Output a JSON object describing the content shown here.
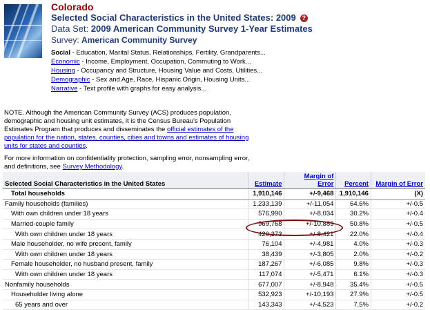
{
  "header": {
    "state": "Colorado",
    "title": "Selected Social Characteristics in the United States: 2009",
    "help_icon": "question-mark-icon",
    "dataset_label": "Data Set:",
    "dataset_value": "2009 American Community Survey 1-Year Estimates",
    "survey_label": "Survey:",
    "survey_value": "American Community Survey"
  },
  "themes": [
    {
      "name": "Social",
      "desc": " - Education, Marital Status, Relationships, Fertility, Grandparents..."
    },
    {
      "name": "Economic",
      "desc": " - Income, Employment, Occupation, Commuting to Work..."
    },
    {
      "name": "Housing",
      "desc": " - Occupancy and Structure, Housing Value and Costs, Utilities..."
    },
    {
      "name": "Demographic",
      "desc": " - Sex and Age, Race, Hispanic Origin, Housing Units..."
    },
    {
      "name": "Narrative",
      "desc": " - Text profile with graphs for easy analysis..."
    }
  ],
  "note": {
    "text": "NOTE. Although the American Community Survey (ACS) produces population, demographic and housing unit estimates, it is the Census Bureau's Population Estimates Program that produces and disseminates the ",
    "link": "official estimates of the population for the nation, states, counties, cities and towns and estimates of housing units for states and counties",
    "end": "."
  },
  "info": {
    "text": "For more information on confidentiality protection, sampling error, nonsampling error, and definitions, see ",
    "link": "Survey Methodology",
    "end": "."
  },
  "table": {
    "headers": {
      "characteristic": "Selected Social Characteristics in the United States",
      "estimate": "Estimate",
      "moe": "Margin of Error",
      "percent": "Percent",
      "moe2": "Margin of Error"
    },
    "rows": [
      {
        "label": "Total households",
        "estimate": "1,910,146",
        "moe": "+/-9,468",
        "percent": "1,910,146",
        "moe2": "(X)"
      },
      {
        "label": "Family households (families)",
        "estimate": "1,233,139",
        "moe": "+/-11,054",
        "percent": "64.6%",
        "moe2": "+/-0.5"
      },
      {
        "label": "With own children under 18 years",
        "estimate": "576,990",
        "moe": "+/-8,034",
        "percent": "30.2%",
        "moe2": "+/-0.4"
      },
      {
        "label": "Married-couple family",
        "estimate": "969,768",
        "moe": "+/-10,889",
        "percent": "50.8%",
        "moe2": "+/-0.5"
      },
      {
        "label": "With own children under 18 years",
        "estimate": "420,373",
        "moe": "+/-8,421",
        "percent": "22.0%",
        "moe2": "+/-0.4"
      },
      {
        "label": "Male householder, no wife present, family",
        "estimate": "76,104",
        "moe": "+/-4,981",
        "percent": "4.0%",
        "moe2": "+/-0.3"
      },
      {
        "label": "With own children under 18 years",
        "estimate": "38,439",
        "moe": "+/-3,805",
        "percent": "2.0%",
        "moe2": "+/-0.2"
      },
      {
        "label": "Female householder, no husband present, family",
        "estimate": "187,267",
        "moe": "+/-6,085",
        "percent": "9.8%",
        "moe2": "+/-0.3"
      },
      {
        "label": "With own children under 18 years",
        "estimate": "117,074",
        "moe": "+/-5,471",
        "percent": "6.1%",
        "moe2": "+/-0.3"
      },
      {
        "label": "Nonfamily households",
        "estimate": "677,007",
        "moe": "+/-8,948",
        "percent": "35.4%",
        "moe2": "+/-0.5"
      },
      {
        "label": "Householder living alone",
        "estimate": "532,923",
        "moe": "+/-10,193",
        "percent": "27.9%",
        "moe2": "+/-0.5"
      },
      {
        "label": "65 years and over",
        "estimate": "143,343",
        "moe": "+/-4,523",
        "percent": "7.5%",
        "moe2": "+/-0.2"
      }
    ]
  },
  "colors": {
    "state": "#8b0000",
    "title": "#1f3a78",
    "link": "#0000cc",
    "highlight": "#7a0f14"
  }
}
